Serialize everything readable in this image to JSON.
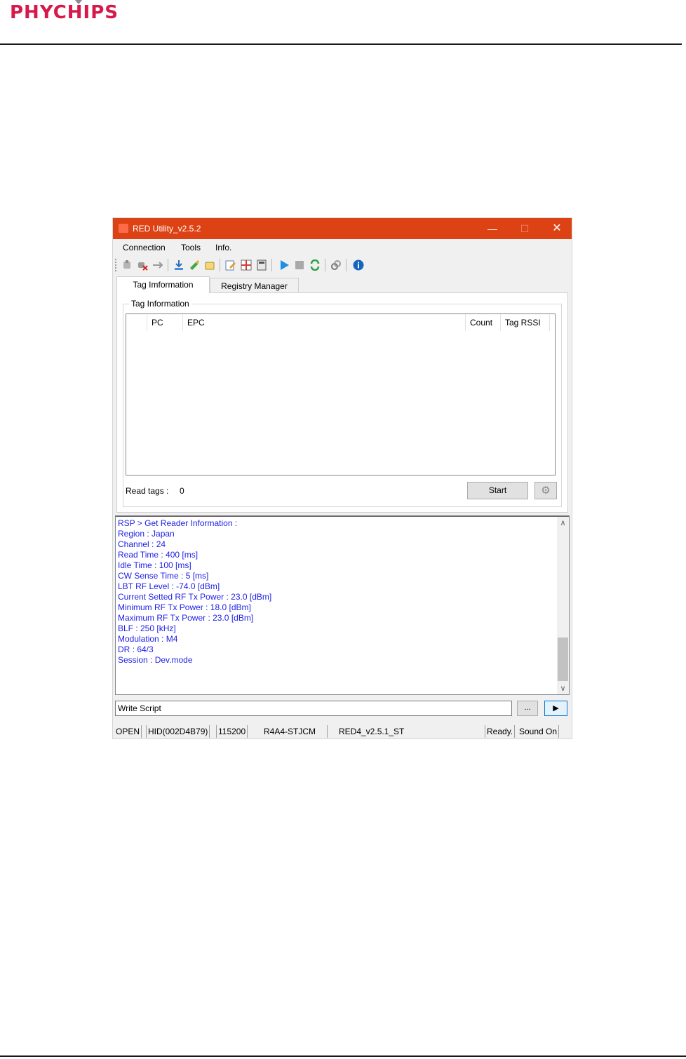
{
  "doc": {
    "logo_text": "PHYCHIPS"
  },
  "window": {
    "title": "RED Utility_v2.5.2",
    "controls": {
      "minimize": "—",
      "maximize": "☐",
      "close": "✕"
    }
  },
  "menu": [
    "Connection",
    "Tools",
    "Info."
  ],
  "toolbar_icons": [
    "connect-icon",
    "disconnect-icon",
    "usb-icon",
    "download-icon",
    "write-icon",
    "erase-icon",
    "edit-icon",
    "grid-icon",
    "memory-icon",
    "play-icon",
    "stop-icon",
    "refresh-icon",
    "link-icon",
    "info-icon"
  ],
  "tabs": {
    "active": "Tag Imformation",
    "inactive": "Registry Manager"
  },
  "tag_info": {
    "group_title": "Tag Information",
    "columns": [
      "PC",
      "EPC",
      "Count",
      "Tag RSSI"
    ],
    "read_tags_label": "Read tags :",
    "read_tags_value": "0",
    "start_label": "Start",
    "gear_icon": "gear-icon"
  },
  "log": [
    "RSP > Get Reader Information :",
    "Region : Japan",
    "Channel : 24",
    "Read Time : 400 [ms]",
    "Idle Time : 100 [ms]",
    "CW Sense Time : 5 [ms]",
    "LBT RF Level : -74.0 [dBm]",
    "Current Setted RF Tx Power : 23.0 [dBm]",
    "Minimum RF Tx Power : 18.0 [dBm]",
    "Maximum RF Tx Power : 23.0 [dBm]",
    "BLF : 250 [kHz]",
    "Modulation : M4",
    "DR :  64/3",
    "Session : Dev.mode"
  ],
  "script": {
    "value": "Write Script",
    "browse_label": "...",
    "run_label": "▶"
  },
  "status": {
    "port_state": "OPEN",
    "device": "HID(002D4B79)",
    "baud": "115200",
    "model": "R4A4-STJCM",
    "firmware": "RED4_v2.5.1_ST",
    "state": "Ready.",
    "sound": "Sound On"
  },
  "colors": {
    "titlebar": "#dd4215",
    "log_text": "#1e1ee6",
    "logo": "#d6184a"
  }
}
